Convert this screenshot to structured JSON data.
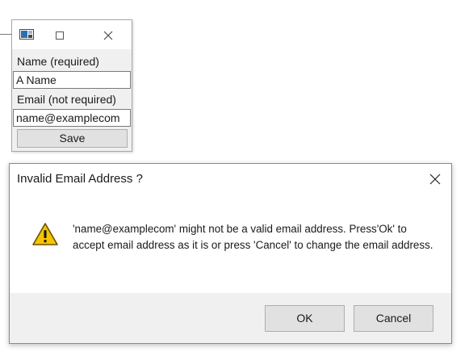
{
  "form_window": {
    "icons": {
      "app": "app-window-icon",
      "maximize": "maximize-icon",
      "close": "close-icon"
    },
    "name_label": "Name (required)",
    "name_value": "A Name",
    "email_label": "Email (not required)",
    "email_value": "name@examplecom",
    "save_label": "Save"
  },
  "dialog": {
    "title": "Invalid Email Address ?",
    "icons": {
      "warning": "warning-icon",
      "close": "close-icon"
    },
    "message": "'name@examplecom' might not be a valid email address. Press'Ok' to accept email address as it is or press 'Cancel' to change the email address.",
    "ok_label": "OK",
    "cancel_label": "Cancel"
  },
  "colors": {
    "warning_fill": "#f6c400",
    "warning_outline": "#6b4e00",
    "button_face": "#e1e1e1",
    "footer_bg": "#f0f0f0"
  }
}
